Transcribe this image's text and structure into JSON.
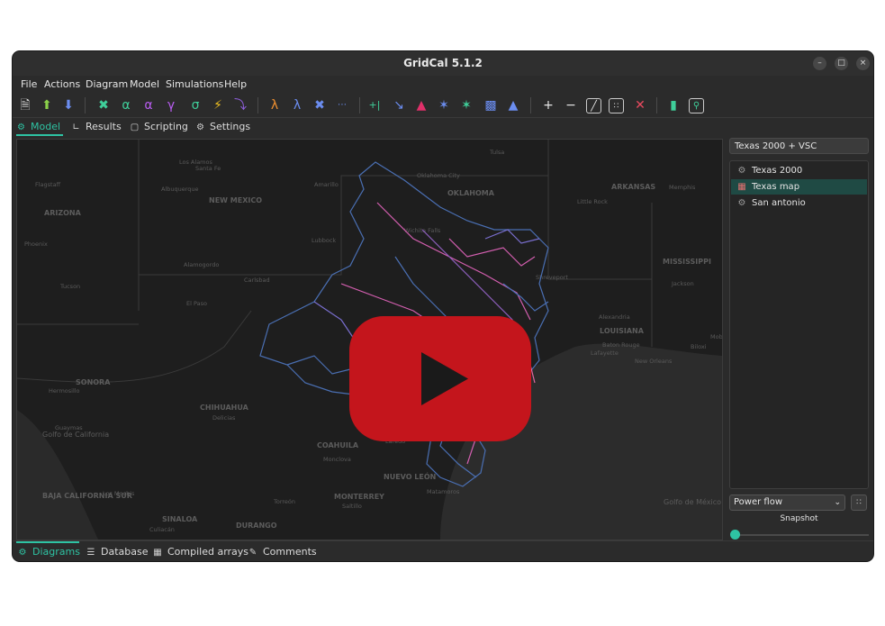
{
  "window": {
    "title": "GridCal 5.1.2",
    "controls": {
      "minimize": "–",
      "maximize": "□",
      "close": "×"
    }
  },
  "menu": [
    "File",
    "Actions",
    "Diagram",
    "Model",
    "Simulations",
    "Help"
  ],
  "toolbar": {
    "icons": [
      "new-file-icon",
      "upload-icon",
      "download-icon",
      "connect-icon",
      "alpha-icon",
      "sensitivity-icon",
      "gamma-icon",
      "sigma-icon",
      "lightning-icon",
      "curve-icon",
      "lambda-icon",
      "lambda-alt-icon",
      "network-icon",
      "dashed-lines-icon",
      "add-branch-icon",
      "chart-down-icon",
      "triangle-icon",
      "cluster-icon",
      "scatter-icon",
      "bar-chart-icon",
      "area-chart-icon",
      "plus-icon",
      "minus-icon",
      "edit-icon",
      "grid-settings-icon",
      "close-icon",
      "bar-stats-icon",
      "search-chart-icon"
    ]
  },
  "tabs": {
    "model": "Model",
    "results": "Results",
    "scripting": "Scripting",
    "settings": "Settings"
  },
  "map": {
    "state_labels": [
      "ARIZONA",
      "NEW MEXICO",
      "OKLAHOMA",
      "ARKANSAS",
      "MISSISSIPPI",
      "LOUISIANA",
      "SONORA",
      "CHIHUAHUA",
      "COAHUILA",
      "NUEVO LEÓN",
      "BAJA CALIFORNIA SUR",
      "SINALOA",
      "DURANGO",
      "Golfo de California",
      "Golfo de México"
    ],
    "city_labels": [
      "Los Alamos",
      "Santa Fe",
      "Flagstaff",
      "Albuquerque",
      "Amarillo",
      "Oklahoma City",
      "Tulsa",
      "Little Rock",
      "Memphis",
      "Phoenix",
      "Lubbock",
      "Wichita Falls",
      "Alamogordo",
      "Carlsbad",
      "Shreveport",
      "Tucson",
      "El Paso",
      "Jackson",
      "Hermosillo",
      "Alexandria",
      "Baton Rouge",
      "Lafayette",
      "New Orleans",
      "Biloxi",
      "Delicias",
      "Guaymas",
      "Laredo",
      "Monclova",
      "Los Mochis",
      "Torreón",
      "MONTERREY",
      "Saltillo",
      "Matamoros",
      "Culiacán",
      "Mobile"
    ]
  },
  "right_panel": {
    "header": "Texas 2000 + VSC",
    "diagrams": [
      {
        "label": "Texas 2000",
        "icon": "schematic-icon",
        "selected": false
      },
      {
        "label": "Texas map",
        "icon": "map-icon",
        "selected": true
      },
      {
        "label": "San antonio",
        "icon": "schematic-icon",
        "selected": false
      }
    ],
    "simulation_select": "Power flow",
    "snapshot_label": "Snapshot",
    "slider_position": 0
  },
  "bottom_tabs": {
    "diagrams": "Diagrams",
    "database": "Database",
    "compiled_arrays": "Compiled arrays",
    "comments": "Comments"
  },
  "colors": {
    "accent": "#2ec3a3",
    "play_button": "#c4151c",
    "grid_line_blue": "#4a6fb3",
    "grid_line_pink": "#d45fb0"
  }
}
